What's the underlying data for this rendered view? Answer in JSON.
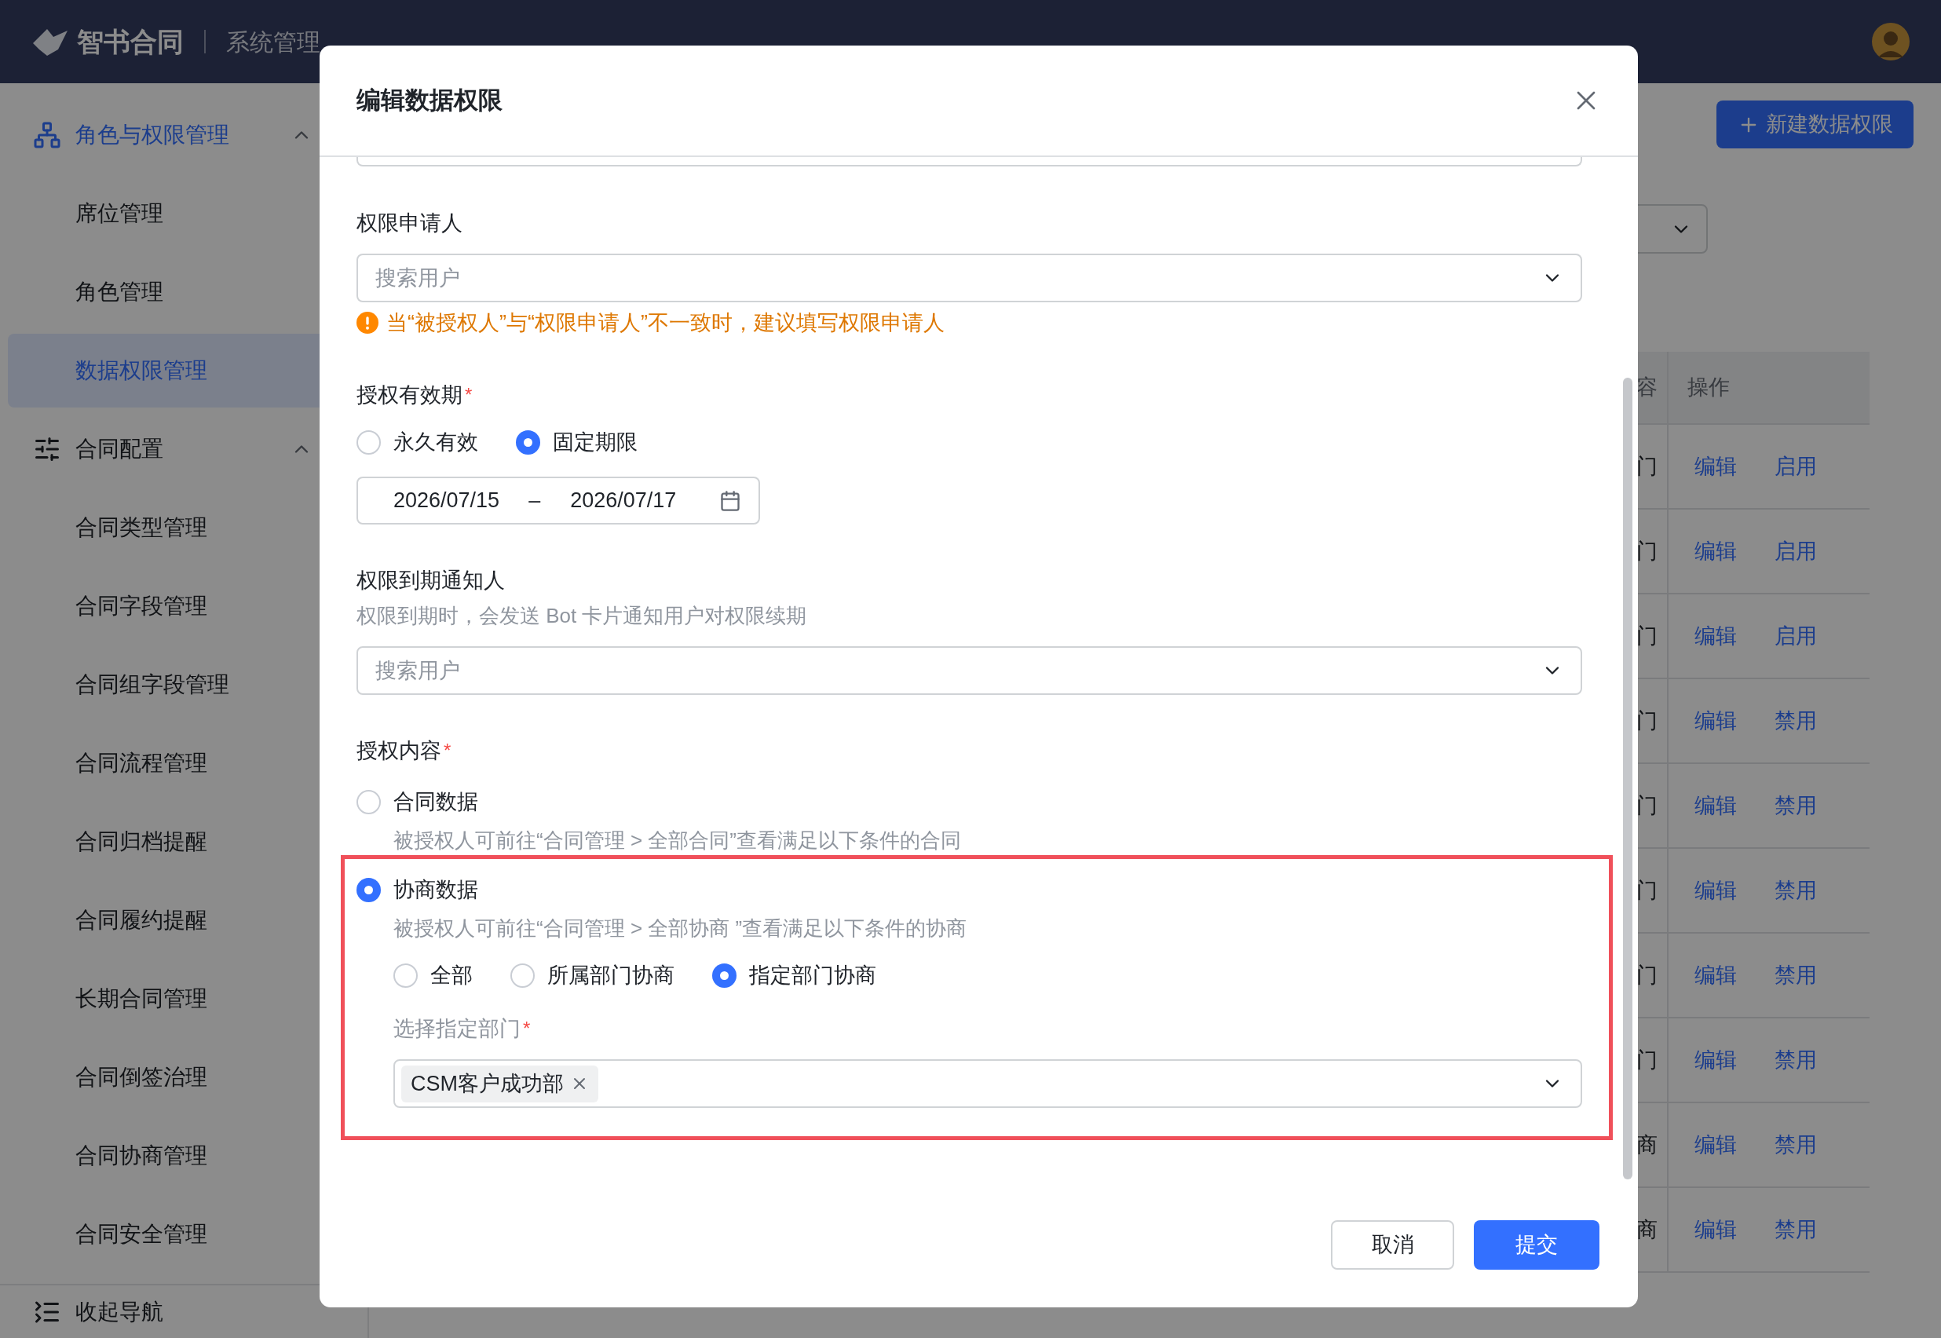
{
  "header": {
    "logo": "智书合同",
    "section": "系统管理"
  },
  "sidebar": {
    "groups": [
      {
        "title": "角色与权限管理",
        "expanded": true,
        "items": [
          {
            "label": "席位管理",
            "selected": false
          },
          {
            "label": "角色管理",
            "selected": false
          },
          {
            "label": "数据权限管理",
            "selected": true
          }
        ]
      },
      {
        "title": "合同配置",
        "expanded": true,
        "items": [
          {
            "label": "合同类型管理",
            "selected": false
          },
          {
            "label": "合同字段管理",
            "selected": false
          },
          {
            "label": "合同组字段管理",
            "selected": false
          },
          {
            "label": "合同流程管理",
            "selected": false
          },
          {
            "label": "合同归档提醒",
            "selected": false
          },
          {
            "label": "合同履约提醒",
            "selected": false
          },
          {
            "label": "长期合同管理",
            "selected": false
          },
          {
            "label": "合同倒签治理",
            "selected": false
          },
          {
            "label": "合同协商管理",
            "selected": false
          },
          {
            "label": "合同安全管理",
            "selected": false
          }
        ]
      }
    ],
    "collapse": "收起导航"
  },
  "page": {
    "new_button": "新建数据权限",
    "table": {
      "columns": [
        "容",
        "操作"
      ],
      "rows": [
        {
          "column_1": "门",
          "actions": [
            "编辑",
            "启用"
          ]
        },
        {
          "column_1": "门",
          "actions": [
            "编辑",
            "启用"
          ]
        },
        {
          "column_1": "门",
          "actions": [
            "编辑",
            "启用"
          ]
        },
        {
          "column_1": "门",
          "actions": [
            "编辑",
            "禁用"
          ]
        },
        {
          "column_1": "门",
          "actions": [
            "编辑",
            "禁用"
          ]
        },
        {
          "column_1": "门",
          "actions": [
            "编辑",
            "禁用"
          ]
        },
        {
          "column_1": "门",
          "actions": [
            "编辑",
            "禁用"
          ]
        },
        {
          "column_1": "门",
          "actions": [
            "编辑",
            "禁用"
          ]
        },
        {
          "column_1": "商",
          "actions": [
            "编辑",
            "禁用"
          ]
        },
        {
          "column_1": "商",
          "actions": [
            "编辑",
            "禁用"
          ]
        }
      ]
    }
  },
  "dialog": {
    "title": "编辑数据权限",
    "applicant": {
      "label": "权限申请人",
      "placeholder": "搜索用户",
      "warning": "当“被授权人”与“权限申请人”不一致时，建议填写权限申请人"
    },
    "validity": {
      "label": "授权有效期",
      "marker": "*",
      "options": [
        {
          "label": "永久有效",
          "selected": false
        },
        {
          "label": "固定期限",
          "selected": true
        }
      ],
      "start": "2026/07/15",
      "separator": "–",
      "end": "2026/07/17"
    },
    "notifier": {
      "label": "权限到期通知人",
      "hint": "权限到期时，会发送 Bot 卡片通知用户对权限续期",
      "placeholder": "搜索用户"
    },
    "content": {
      "label": "授权内容",
      "marker": "*",
      "options": [
        {
          "label": "合同数据",
          "selected": false,
          "highlighted": false,
          "hint": "被授权人可前往“合同管理 > 全部合同”查看满足以下条件的合同"
        },
        {
          "label": "协商数据",
          "selected": true,
          "highlighted": true,
          "hint": "被授权人可前往“合同管理 > 全部协商 ”查看满足以下条件的协商",
          "scopes": [
            {
              "label": "全部",
              "selected": false
            },
            {
              "label": "所属部门协商",
              "selected": false
            },
            {
              "label": "指定部门协商",
              "selected": true
            }
          ],
          "department": {
            "label": "选择指定部门",
            "marker": "*",
            "tags": [
              "CSM客户成功部"
            ]
          }
        }
      ]
    },
    "buttons": [
      {
        "label": "取消",
        "kind": "secondary"
      },
      {
        "label": "提交",
        "kind": "primary"
      }
    ]
  }
}
